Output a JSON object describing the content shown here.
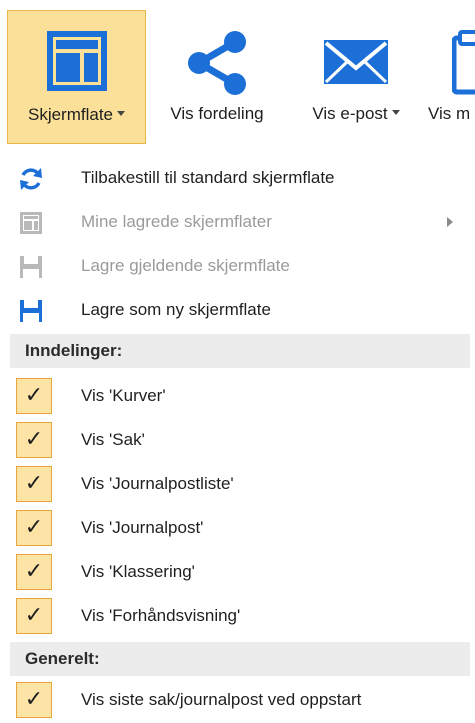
{
  "ribbon": {
    "layout": {
      "label": "Skjermflate",
      "icon": "layout-icon"
    },
    "distribution": {
      "label": "Vis fordeling",
      "icon": "share-icon"
    },
    "email": {
      "label": "Vis e-post",
      "icon": "envelope-icon"
    },
    "more": {
      "label": "Vis m",
      "icon": "clipboard-icon"
    }
  },
  "menu": {
    "actions": [
      {
        "label": "Tilbakestill til standard skjermflate",
        "icon": "refresh-icon",
        "enabled": true
      },
      {
        "label": "Mine lagrede skjermflater",
        "icon": "layout-icon",
        "enabled": false,
        "has_submenu": true
      },
      {
        "label": "Lagre gjeldende skjermflate",
        "icon": "save-icon",
        "enabled": false
      },
      {
        "label": "Lagre som ny skjermflate",
        "icon": "save-as-icon",
        "enabled": true
      }
    ],
    "sections": [
      {
        "title": "Inndelinger:",
        "items": [
          {
            "label": "Vis 'Kurver'",
            "checked": true
          },
          {
            "label": "Vis 'Sak'",
            "checked": true
          },
          {
            "label": "Vis 'Journalpostliste'",
            "checked": true
          },
          {
            "label": "Vis 'Journalpost'",
            "checked": true
          },
          {
            "label": "Vis 'Klassering'",
            "checked": true
          },
          {
            "label": "Vis 'Forhåndsvisning'",
            "checked": true
          }
        ]
      },
      {
        "title": "Generelt:",
        "items": [
          {
            "label": "Vis siste sak/journalpost ved oppstart",
            "checked": true
          }
        ]
      }
    ],
    "check_glyph": "✓"
  },
  "colors": {
    "accent_blue": "#1b6fd6",
    "selected_bg": "#fbe099",
    "check_bg": "#fde4a6",
    "check_border": "#e7a53a",
    "disabled_text": "#9a9a9a"
  }
}
